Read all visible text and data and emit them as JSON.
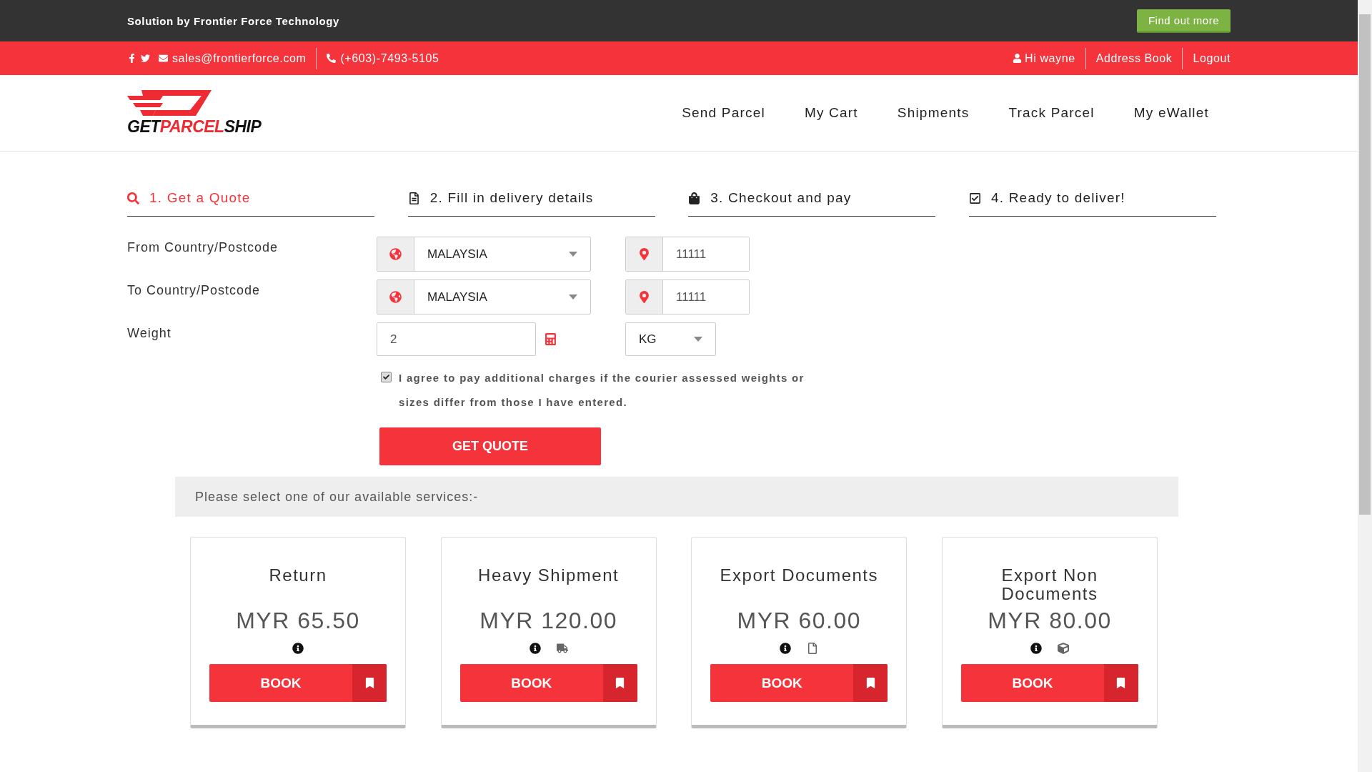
{
  "promo_bar": {
    "text": "Solution by Frontier Force Technology",
    "button": "Find out more"
  },
  "contact_bar": {
    "email": "sales@frontierforce.com",
    "phone": "(+603)-7493-5105",
    "user_links": [
      {
        "label": "Hi wayne",
        "kind": "user"
      },
      {
        "label": "Address Book",
        "kind": "link"
      },
      {
        "label": "Logout",
        "kind": "link"
      }
    ]
  },
  "logo": [
    {
      "text": "GET",
      "accent": false
    },
    {
      "text": "PARCEL",
      "accent": true
    },
    {
      "text": "SHIP",
      "accent": false
    }
  ],
  "nav": [
    "Send Parcel",
    "My Cart",
    "Shipments",
    "Track Parcel",
    "My eWallet"
  ],
  "steps": [
    {
      "label": "1. Get a Quote",
      "kind": "search",
      "selected": true
    },
    {
      "label": "2. Fill in delivery details",
      "kind": "file",
      "selected": false
    },
    {
      "label": "3. Checkout and pay",
      "kind": "bag",
      "selected": false
    },
    {
      "label": "4. Ready to deliver!",
      "kind": "check",
      "selected": false
    }
  ],
  "form": {
    "from": {
      "label": "From Country/Postcode",
      "country": "MALAYSIA",
      "postcode": "11111"
    },
    "to": {
      "label": "To Country/Postcode",
      "country": "MALAYSIA",
      "postcode": "11111"
    },
    "weight": {
      "label": "Weight",
      "value": "2",
      "unit": "KG"
    },
    "agree": {
      "checked": true,
      "text": "I agree to pay additional charges if the courier assessed weights or sizes differ from those I have entered."
    },
    "submit": "GET QUOTE"
  },
  "services_prompt": "Please select one of our available services:-",
  "services": [
    {
      "name": "Return",
      "price": "MYR 65.50",
      "icons": [
        {
          "kind": "info"
        }
      ],
      "button": "BOOK"
    },
    {
      "name": "Heavy Shipment",
      "price": "MYR 120.00",
      "icons": [
        {
          "kind": "info"
        },
        {
          "kind": "truck"
        }
      ],
      "button": "BOOK"
    },
    {
      "name": "Export Documents",
      "price": "MYR 60.00",
      "icons": [
        {
          "kind": "info"
        },
        {
          "kind": "file"
        }
      ],
      "button": "BOOK"
    },
    {
      "name": "Export Non Documents",
      "price": "MYR 80.00",
      "icons": [
        {
          "kind": "info"
        },
        {
          "kind": "cube"
        }
      ],
      "button": "BOOK"
    }
  ]
}
